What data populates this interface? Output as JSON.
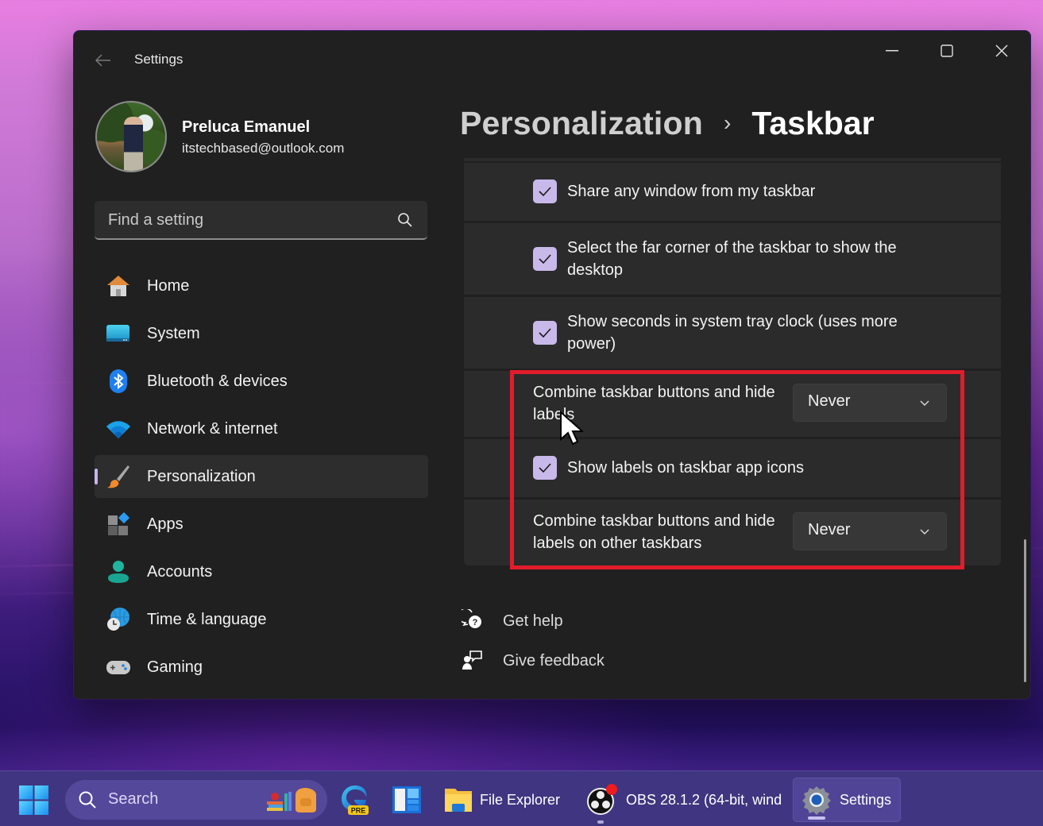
{
  "window": {
    "title": "Settings",
    "controls": {
      "minimize": "minimize",
      "maximize": "maximize",
      "close": "close"
    }
  },
  "profile": {
    "name": "Preluca Emanuel",
    "email": "itstechbased@outlook.com"
  },
  "search": {
    "placeholder": "Find a setting"
  },
  "sidebar": {
    "items": [
      {
        "label": "Home",
        "icon": "home-icon",
        "active": false
      },
      {
        "label": "System",
        "icon": "system-icon",
        "active": false
      },
      {
        "label": "Bluetooth & devices",
        "icon": "bluetooth-icon",
        "active": false
      },
      {
        "label": "Network & internet",
        "icon": "wifi-icon",
        "active": false
      },
      {
        "label": "Personalization",
        "icon": "paintbrush-icon",
        "active": true
      },
      {
        "label": "Apps",
        "icon": "apps-icon",
        "active": false
      },
      {
        "label": "Accounts",
        "icon": "accounts-icon",
        "active": false
      },
      {
        "label": "Time & language",
        "icon": "time-language-icon",
        "active": false
      },
      {
        "label": "Gaming",
        "icon": "gamepad-icon",
        "active": false
      }
    ]
  },
  "breadcrumb": {
    "parent": "Personalization",
    "separator": "›",
    "current": "Taskbar"
  },
  "settings": {
    "share_window": {
      "label": "Share any window from my taskbar",
      "checked": true
    },
    "far_corner": {
      "label": "Select the far corner of the taskbar to show the desktop",
      "checked": true
    },
    "show_seconds": {
      "label": "Show seconds in system tray clock (uses more power)",
      "checked": true
    },
    "combine_buttons": {
      "label": "Combine taskbar buttons and hide labels",
      "value": "Never"
    },
    "show_labels": {
      "label": "Show labels on taskbar app icons",
      "checked": true
    },
    "combine_other": {
      "label": "Combine taskbar buttons and hide labels on other taskbars",
      "value": "Never"
    }
  },
  "links": {
    "help": "Get help",
    "feedback": "Give feedback"
  },
  "colors": {
    "accent": "#c8b9ea",
    "highlight": "#e21c2b",
    "window_bg": "#202020",
    "card_bg": "#2b2b2b"
  },
  "taskbar": {
    "search_label": "Search",
    "apps": [
      {
        "label": "",
        "name": "edge-preview",
        "badge": "PRE"
      },
      {
        "label": "",
        "name": "widgets-app"
      },
      {
        "label": "File Explorer",
        "name": "file-explorer"
      },
      {
        "label": "OBS 28.1.2 (64-bit, wind",
        "name": "obs-studio",
        "running": true
      },
      {
        "label": "Settings",
        "name": "settings",
        "active": true
      }
    ]
  }
}
